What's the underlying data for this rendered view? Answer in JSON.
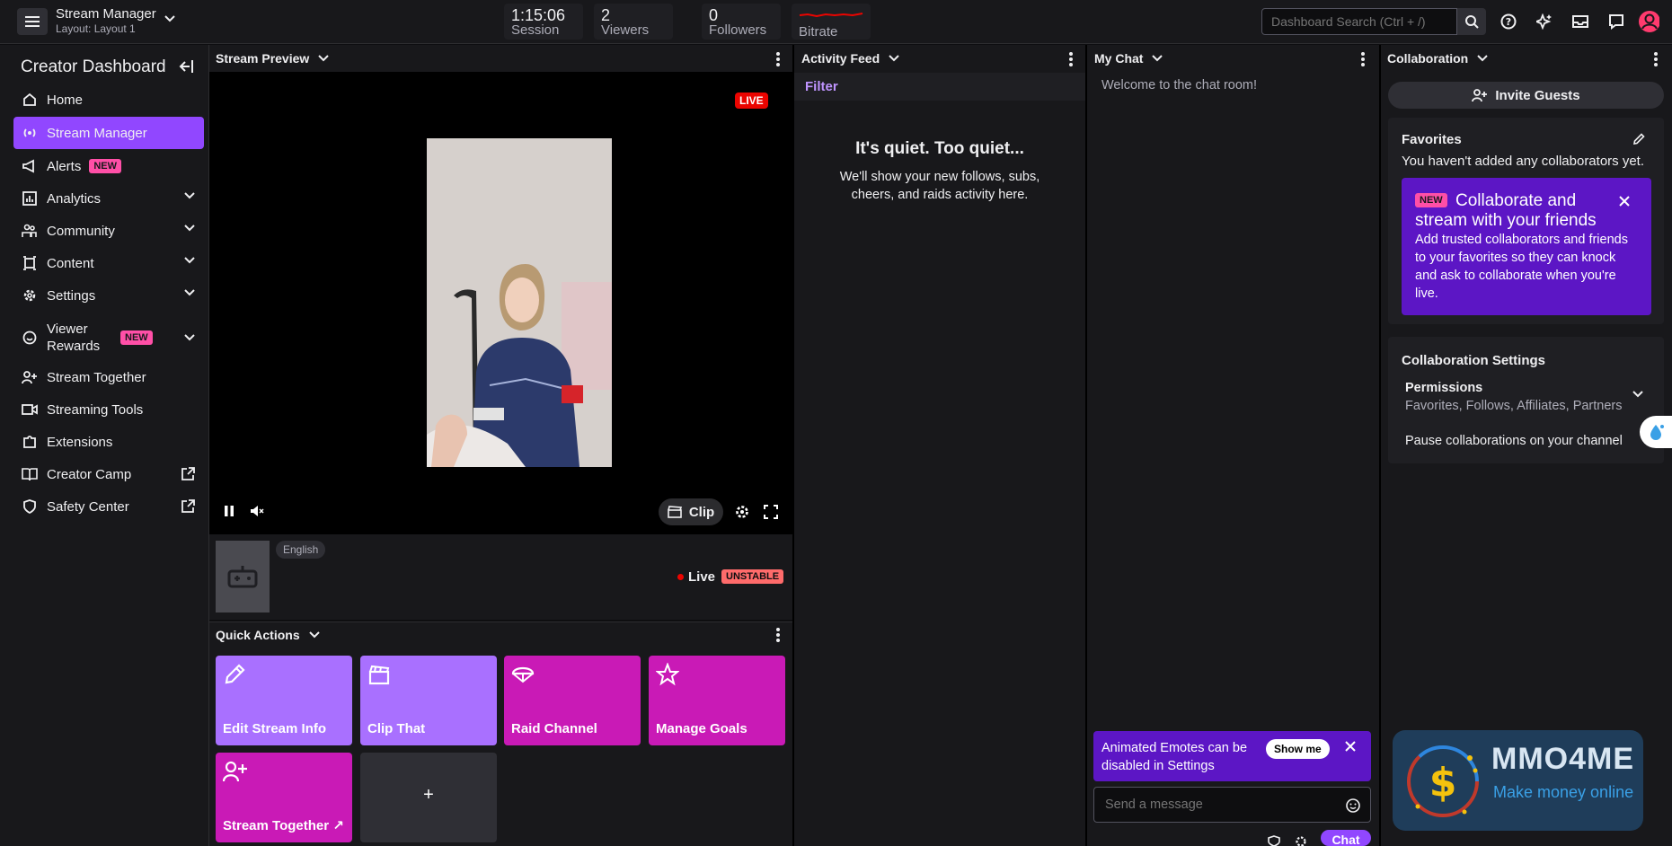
{
  "topbar": {
    "app_title": "Stream Manager",
    "layout_label": "Layout: Layout 1",
    "stats": [
      {
        "value": "1:15:06",
        "label": "Session"
      },
      {
        "value": "2",
        "label": "Viewers"
      },
      {
        "value": "0",
        "label": "Followers"
      },
      {
        "value": "",
        "label": "Bitrate"
      }
    ],
    "search_placeholder": "Dashboard Search (Ctrl + /)"
  },
  "sidebar": {
    "title": "Creator Dashboard",
    "items": [
      {
        "label": "Home"
      },
      {
        "label": "Stream Manager"
      },
      {
        "label": "Alerts",
        "badge": "NEW"
      },
      {
        "label": "Analytics"
      },
      {
        "label": "Community"
      },
      {
        "label": "Content"
      },
      {
        "label": "Settings"
      },
      {
        "label": "Viewer Rewards",
        "badge": "NEW"
      },
      {
        "label": "Stream Together"
      },
      {
        "label": "Streaming Tools"
      },
      {
        "label": "Extensions"
      },
      {
        "label": "Creator Camp"
      },
      {
        "label": "Safety Center"
      }
    ]
  },
  "preview": {
    "header": "Stream Preview",
    "live_tag": "LIVE",
    "clip_label": "Clip",
    "language": "English",
    "status": "Live",
    "health": "UNSTABLE"
  },
  "quick_actions": {
    "header": "Quick Actions",
    "tiles": [
      {
        "label": "Edit Stream Info"
      },
      {
        "label": "Clip That"
      },
      {
        "label": "Raid Channel"
      },
      {
        "label": "Manage Goals"
      },
      {
        "label": "Stream Together ↗"
      },
      {
        "label": "+"
      }
    ]
  },
  "activity": {
    "header": "Activity Feed",
    "filter": "Filter",
    "empty_title": "It's quiet. Too quiet...",
    "empty_body": "We'll show your new follows, subs, cheers, and raids activity here."
  },
  "chat": {
    "header": "My Chat",
    "welcome": "Welcome to the chat room!",
    "banner_text": "Animated Emotes can be disabled in Settings",
    "banner_button": "Show me",
    "input_placeholder": "Send a message",
    "send_label": "Chat"
  },
  "collab": {
    "header": "Collaboration",
    "invite_label": "Invite Guests",
    "favorites_title": "Favorites",
    "favorites_empty": "You haven't added any collaborators yet.",
    "promo_badge": "NEW",
    "promo_title": "Collaborate and stream with your friends",
    "promo_body": "Add trusted collaborators and friends to your favorites so they can knock and ask to collaborate when you're live.",
    "settings_title": "Collaboration Settings",
    "permissions_title": "Permissions",
    "permissions_value": "Favorites, Follows, Affiliates, Partners",
    "pause_label": "Pause collaborations on your channel"
  },
  "watermark": {
    "name": "MMO4ME",
    "tagline": "Make money online"
  },
  "colors": {
    "accent": "#9147ff",
    "live": "#eb0400",
    "magenta": "#c91ab6"
  }
}
